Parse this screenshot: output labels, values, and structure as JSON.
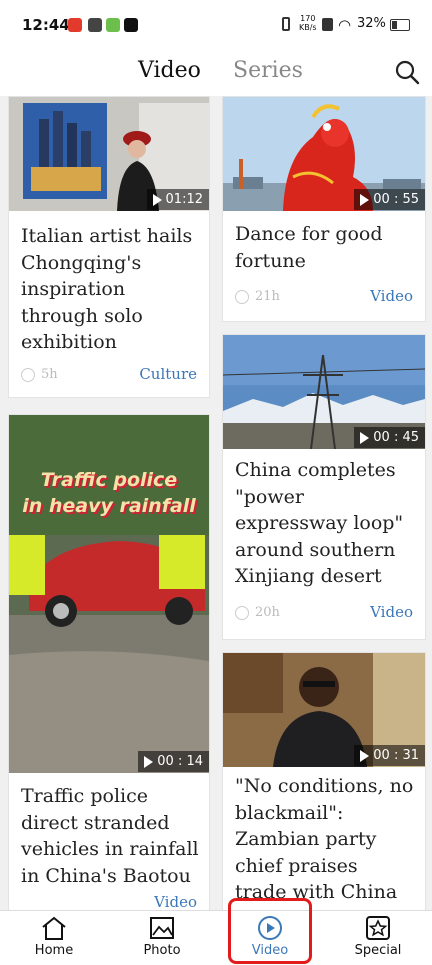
{
  "status_bar": {
    "time": "12:44",
    "net_speed_top": "170",
    "net_speed_bottom": "KB/s",
    "battery": "32%"
  },
  "header": {
    "tabs": [
      {
        "label": "Video",
        "active": true
      },
      {
        "label": "Series",
        "active": false
      }
    ],
    "search_icon": "search-icon"
  },
  "cards": [
    {
      "title": "Italian artist hails Chongqing's inspiration through solo exhibition",
      "duration": "01:12",
      "time_ago": "5h",
      "category": "Culture"
    },
    {
      "title": "Dance for good fortune",
      "duration": "00 : 55",
      "time_ago": "21h",
      "category": "Video"
    },
    {
      "title": "China completes \"power expressway loop\" around southern Xinjiang desert",
      "duration": "00 : 45",
      "time_ago": "20h",
      "category": "Video"
    },
    {
      "title": "Traffic police direct stranded vehicles in rainfall in China's Baotou",
      "duration": "00 : 14",
      "overlay_text_line1": "Traffic police",
      "overlay_text_line2": "in heavy rainfall",
      "time_ago": "",
      "category": "Video"
    },
    {
      "title": "\"No conditions, no blackmail\": Zambian party chief praises trade with China",
      "duration": "00 : 31",
      "time_ago": "",
      "category": ""
    }
  ],
  "bottom_nav": [
    {
      "label": "Home",
      "icon": "home-icon",
      "active": false
    },
    {
      "label": "Photo",
      "icon": "photo-icon",
      "active": false
    },
    {
      "label": "Video",
      "icon": "play-circle-icon",
      "active": true
    },
    {
      "label": "Special",
      "icon": "star-icon",
      "active": false
    }
  ],
  "colors": {
    "accent": "#3a78b8",
    "highlight": "#e21c1c",
    "background": "#f0f0f0"
  }
}
